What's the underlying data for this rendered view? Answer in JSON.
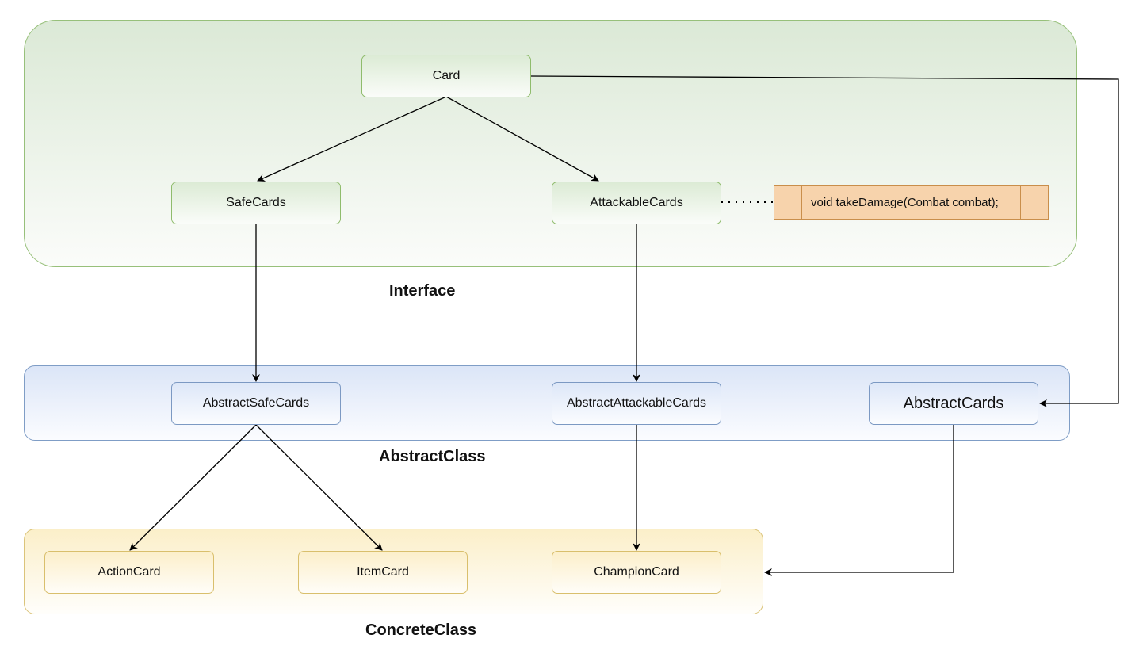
{
  "containers": {
    "interface": {
      "label": "Interface"
    },
    "abstract": {
      "label": "AbstractClass"
    },
    "concrete": {
      "label": "ConcreteClass"
    }
  },
  "nodes": {
    "card": "Card",
    "safe_cards": "SafeCards",
    "attackable_cards": "AttackableCards",
    "abstract_safe_cards": "AbstractSafeCards",
    "abstract_attackable_cards": "AbstractAttackableCards",
    "abstract_cards": "AbstractCards",
    "action_card": "ActionCard",
    "item_card": "ItemCard",
    "champion_card": "ChampionCard"
  },
  "method_note": {
    "text": "void takeDamage(Combat combat);"
  },
  "edges": [
    {
      "from": "Card",
      "to": "SafeCards",
      "style": "arrow"
    },
    {
      "from": "Card",
      "to": "AttackableCards",
      "style": "arrow"
    },
    {
      "from": "Card",
      "to": "AbstractCards",
      "style": "arrow"
    },
    {
      "from": "SafeCards",
      "to": "AbstractSafeCards",
      "style": "arrow"
    },
    {
      "from": "AttackableCards",
      "to": "AbstractAttackableCards",
      "style": "arrow"
    },
    {
      "from": "AttackableCards",
      "to": "void takeDamage(Combat combat);",
      "style": "dotted"
    },
    {
      "from": "AbstractSafeCards",
      "to": "ActionCard",
      "style": "arrow"
    },
    {
      "from": "AbstractSafeCards",
      "to": "ItemCard",
      "style": "arrow"
    },
    {
      "from": "AbstractAttackableCards",
      "to": "ChampionCard",
      "style": "arrow"
    },
    {
      "from": "AbstractCards",
      "to": "ConcreteClass",
      "style": "arrow"
    }
  ]
}
